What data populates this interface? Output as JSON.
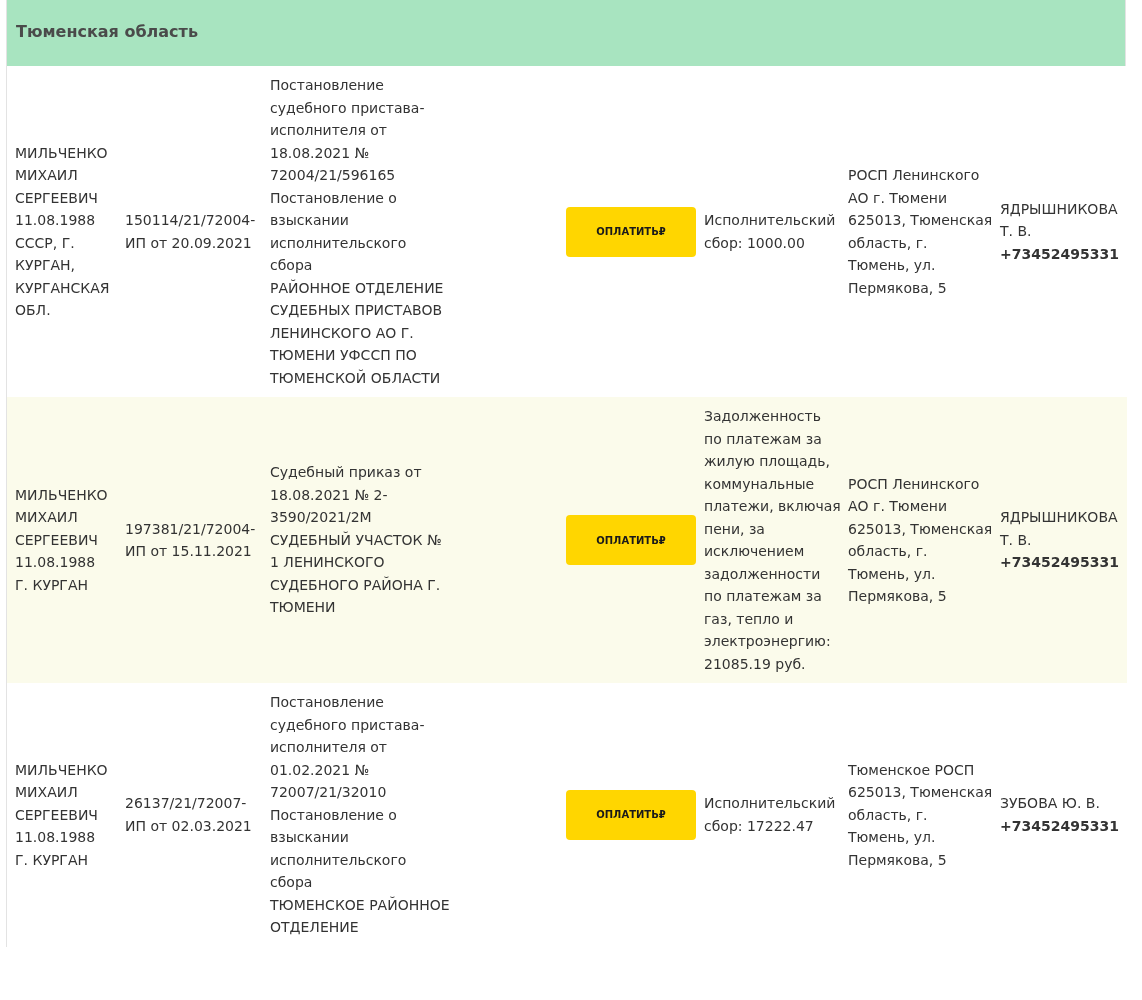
{
  "region": {
    "title": "Тюменская область"
  },
  "rows": [
    {
      "debtor": "МИЛЬЧЕНКО МИХАИЛ СЕРГЕЕВИЧ\n11.08.1988\nСССР, Г. КУРГАН, КУРГАНСКАЯ ОБЛ.",
      "proceeding": "150114/21/72004-ИП от 20.09.2021",
      "document": "Постановление судебного пристава-исполнителя от 18.08.2021 № 72004/21/596165\nПостановление о взыскании исполнительского сбора\nРАЙОННОЕ ОТДЕЛЕНИЕ СУДЕБНЫХ ПРИСТАВОВ ЛЕНИНСКОГО АО Г. ТЮМЕНИ УФССП ПО ТЮМЕНСКОЙ ОБЛАСТИ",
      "pay_button": "ОПЛАТИТЬ₽",
      "subject": "Исполнительский сбор: 1000.00",
      "department": "РОСП Ленинского АО г. Тюмени\n625013, Тюменская область, г. Тюмень, ул. Пермякова, 5",
      "bailiff": "ЯДРЫШНИКОВА Т. В.",
      "phone": "+73452495331"
    },
    {
      "debtor": "МИЛЬЧЕНКО МИХАИЛ СЕРГЕЕВИЧ\n11.08.1988\nГ. КУРГАН",
      "proceeding": "197381/21/72004-ИП от 15.11.2021",
      "document": "Судебный приказ от 18.08.2021 № 2-3590/2021/2М\nСУДЕБНЫЙ УЧАСТОК № 1 ЛЕНИНСКОГО СУДЕБНОГО РАЙОНА Г. ТЮМЕНИ",
      "pay_button": "ОПЛАТИТЬ₽",
      "subject": "Задолженность по платежам за жилую площадь, коммунальные платежи, включая пени, за исключением задолженности по платежам за газ, тепло и электроэнергию: 21085.19 руб.",
      "department": "РОСП Ленинского АО г. Тюмени\n625013, Тюменская область, г. Тюмень, ул. Пермякова, 5",
      "bailiff": "ЯДРЫШНИКОВА Т. В.",
      "phone": "+73452495331"
    },
    {
      "debtor": "МИЛЬЧЕНКО МИХАИЛ СЕРГЕЕВИЧ\n11.08.1988\nГ. КУРГАН",
      "proceeding": "26137/21/72007-ИП от 02.03.2021",
      "document": "Постановление судебного пристава-исполнителя от 01.02.2021 № 72007/21/32010\nПостановление о взыскании исполнительского сбора\nТЮМЕНСКОЕ РАЙОННОЕ ОТДЕЛЕНИЕ",
      "pay_button": "ОПЛАТИТЬ₽",
      "subject": "Исполнительский сбор: 17222.47",
      "department": "Тюменское РОСП\n625013, Тюменская область, г. Тюмень, ул. Пермякова, 5",
      "bailiff": "ЗУБОВА Ю. В.",
      "phone": "+73452495331"
    }
  ]
}
